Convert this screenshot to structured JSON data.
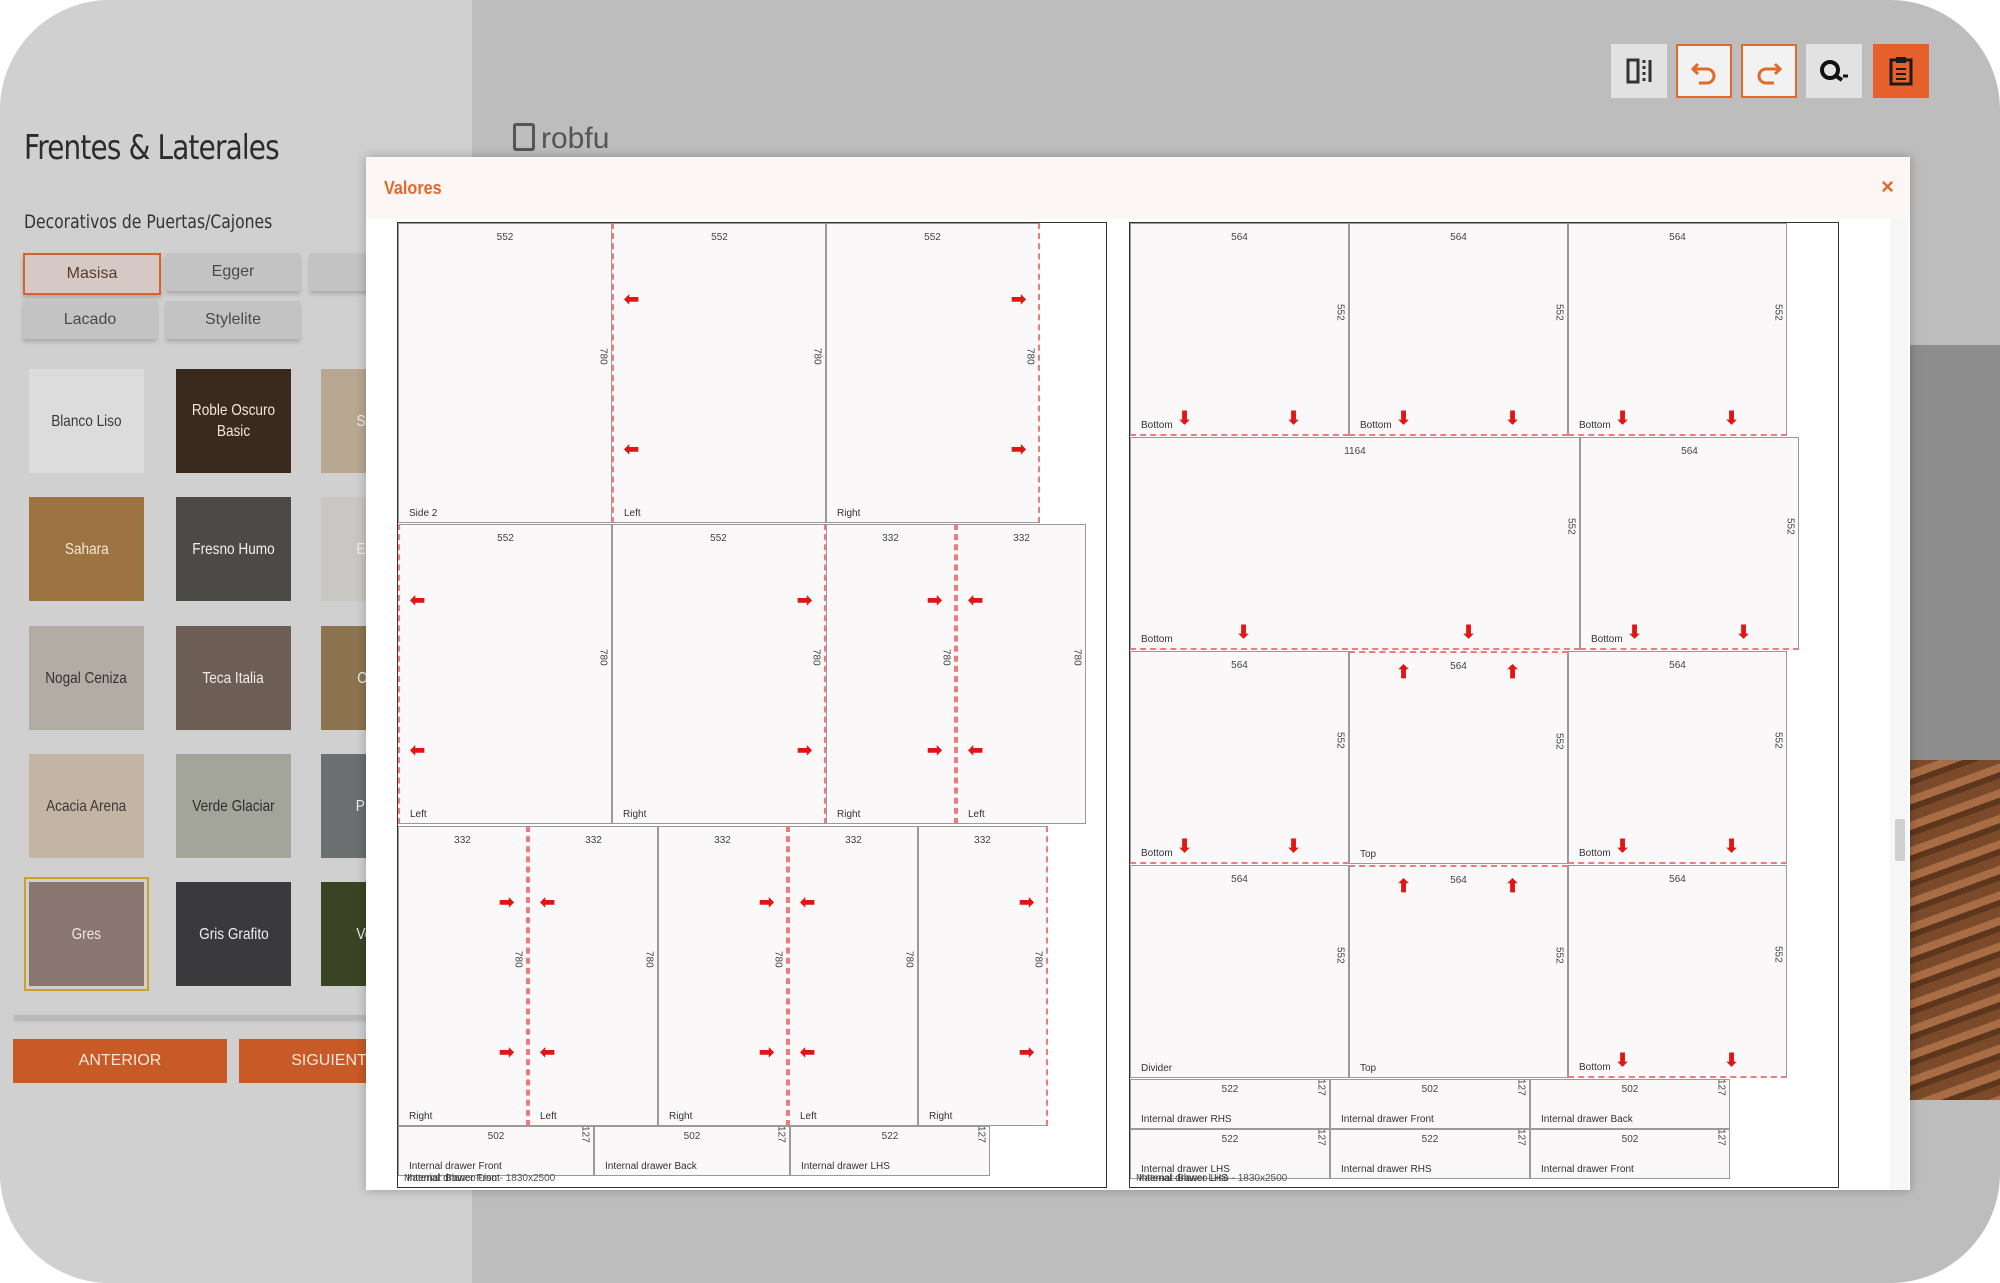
{
  "sidebar": {
    "title": "Frentes & Laterales",
    "subtitle": "Decorativos de Puertas/Cajones",
    "chips": [
      "Masisa",
      "Egger",
      "Lacado",
      "Stylelite"
    ],
    "active_chip": "Masisa",
    "swatches": [
      {
        "label": "Blanco Liso",
        "color": "#dcdcdc",
        "text_color": "#3a3a3a"
      },
      {
        "label": "Roble Oscuro Basic",
        "color": "#3a2a1e",
        "text_color": "#f0e6da"
      },
      {
        "label": "Sahara",
        "color": "#9e7342",
        "text_color": "#f4e6d4"
      },
      {
        "label": "Fresno Humo",
        "color": "#4c4a47",
        "text_color": "#f0f0f0"
      },
      {
        "label": "Nogal Ceniza",
        "color": "#b3aca4",
        "text_color": "#333333"
      },
      {
        "label": "Teca Italia",
        "color": "#6c5d55",
        "text_color": "#f2ecea"
      },
      {
        "label": "Acacia Arena",
        "color": "#c4b4a3",
        "text_color": "#3a3a3a"
      },
      {
        "label": "Verde Glaciar",
        "color": "#a4a59a",
        "text_color": "#2e2e2e"
      },
      {
        "label": "Gres",
        "color": "#8a7670",
        "text_color": "#f1e7e2"
      },
      {
        "label": "Gris Grafito",
        "color": "#3a3a3c",
        "text_color": "#f0f0f0"
      }
    ],
    "partial_swatches": [
      {
        "label": "Sa",
        "color": "#b8a791"
      },
      {
        "label": "Es",
        "color": "#c9c7c4"
      },
      {
        "label": "Olm",
        "color": "#8c7450"
      },
      {
        "label": "P",
        "color": "#6b6f70"
      },
      {
        "label": "Ve",
        "color": "#3a4425"
      }
    ],
    "prev_button": "ANTERIOR",
    "next_button": "SIGUIENT"
  },
  "brand": {
    "logo": "robfu"
  },
  "toolbar": {
    "buttons": [
      {
        "icon": "split-view-icon",
        "style": "plain"
      },
      {
        "icon": "undo-icon",
        "style": "outline"
      },
      {
        "icon": "redo-icon",
        "style": "outline"
      },
      {
        "icon": "search-zoom-icon",
        "style": "plain"
      },
      {
        "icon": "clipboard-icon",
        "style": "filled"
      }
    ]
  },
  "modal": {
    "title": "Valores",
    "close": "×",
    "sheets": [
      {
        "label": "Material: Blanco Liso - 1830x2500",
        "overlap_label": "Internal drawer Front",
        "pieces": [
          {
            "w": "552",
            "h": "780",
            "name": "Side 2"
          },
          {
            "w": "552",
            "h": "780",
            "name": "Left"
          },
          {
            "w": "552",
            "h": "780",
            "name": "Right"
          },
          {
            "w": "552",
            "h": "780",
            "name": "Left"
          },
          {
            "w": "552",
            "h": "780",
            "name": "Right"
          },
          {
            "w": "332",
            "h": "780",
            "name": "Right"
          },
          {
            "w": "332",
            "h": "780",
            "name": "Left"
          },
          {
            "w": "332",
            "h": "780",
            "name": "Right"
          },
          {
            "w": "332",
            "h": "780",
            "name": "Left"
          },
          {
            "w": "332",
            "h": "780",
            "name": "Right"
          },
          {
            "w": "332",
            "h": "780",
            "name": "Left"
          },
          {
            "w": "332",
            "h": "780",
            "name": "Right"
          },
          {
            "w": "502",
            "h": "127",
            "name": "Internal drawer Front"
          },
          {
            "w": "502",
            "h": "127",
            "name": "Internal drawer Back"
          },
          {
            "w": "522",
            "h": "127",
            "name": "Internal drawer LHS"
          }
        ]
      },
      {
        "label": "Material: Blanco Liso - 1830x2500",
        "overlap_label": "Internal drawer LHS",
        "pieces": [
          {
            "w": "564",
            "h": "552",
            "name": "Bottom"
          },
          {
            "w": "564",
            "h": "552",
            "name": "Bottom"
          },
          {
            "w": "564",
            "h": "552",
            "name": "Bottom"
          },
          {
            "w": "1164",
            "h": "552",
            "name": "Bottom"
          },
          {
            "w": "564",
            "h": "552",
            "name": "Bottom"
          },
          {
            "w": "564",
            "h": "552",
            "name": "Bottom"
          },
          {
            "w": "564",
            "h": "552",
            "name": "Top"
          },
          {
            "w": "564",
            "h": "552",
            "name": "Bottom"
          },
          {
            "w": "564",
            "h": "552",
            "name": "Divider"
          },
          {
            "w": "564",
            "h": "552",
            "name": "Top"
          },
          {
            "w": "564",
            "h": "552",
            "name": "Bottom"
          },
          {
            "w": "522",
            "h": "127",
            "name": "Internal drawer RHS"
          },
          {
            "w": "502",
            "h": "127",
            "name": "Internal drawer Front"
          },
          {
            "w": "502",
            "h": "127",
            "name": "Internal drawer Back"
          },
          {
            "w": "522",
            "h": "127",
            "name": "Internal drawer LHS"
          },
          {
            "w": "522",
            "h": "127",
            "name": "Internal drawer RHS"
          },
          {
            "w": "502",
            "h": "127",
            "name": "Internal drawer Front"
          }
        ]
      }
    ]
  }
}
